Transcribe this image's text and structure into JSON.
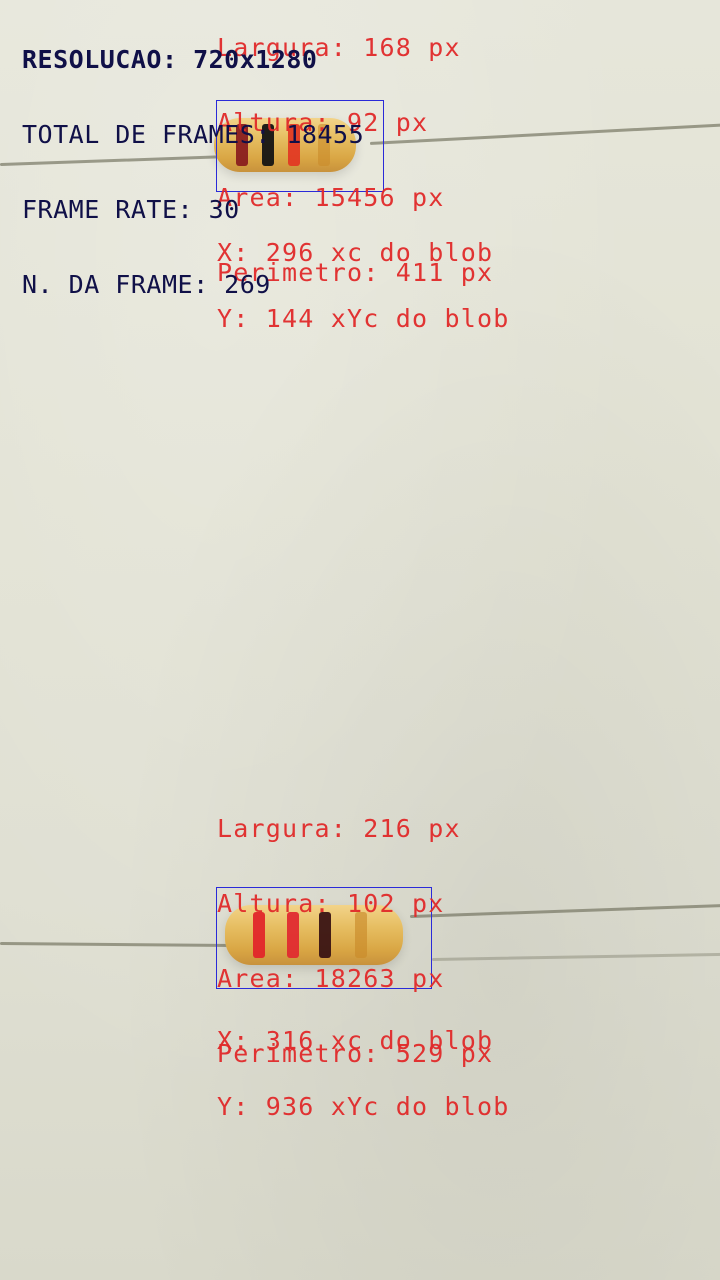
{
  "hud": {
    "resolution": "RESOLUCAO: 720x1280",
    "total_frames": "TOTAL DE FRAMES: 18455",
    "frame_rate": "FRAME RATE: 30",
    "frame_number": "N. DA FRAME: 269"
  },
  "blobs": [
    {
      "stats": {
        "largura": "Largura: 168 px",
        "altura": "Altura: 92 px",
        "area": "Area: 15456 px",
        "perimetro": "Perimetro: 411 px"
      },
      "center": {
        "x": "X: 296 xc do blob",
        "y": "Y: 144 xYc do blob"
      },
      "colors": {
        "band1": "#8a1f1f",
        "band2": "#141414",
        "band3": "#e23a24",
        "band4": "#c98b2a"
      }
    },
    {
      "stats": {
        "largura": "Largura: 216 px",
        "altura": "Altura: 102 px",
        "area": "Area: 18263 px",
        "perimetro": "Perimetro: 529 px"
      },
      "center": {
        "x": "X: 316 xc do blob",
        "y": "Y: 936 xYc do blob"
      },
      "colors": {
        "band1": "#e2262a",
        "band2": "#e02b30",
        "band3": "#3a1414",
        "band4": "#c98b2a"
      }
    }
  ],
  "colors": {
    "overlay_red": "#e12a2a",
    "bbox_blue": "#2a2ad8",
    "hud_navy": "#101048"
  }
}
